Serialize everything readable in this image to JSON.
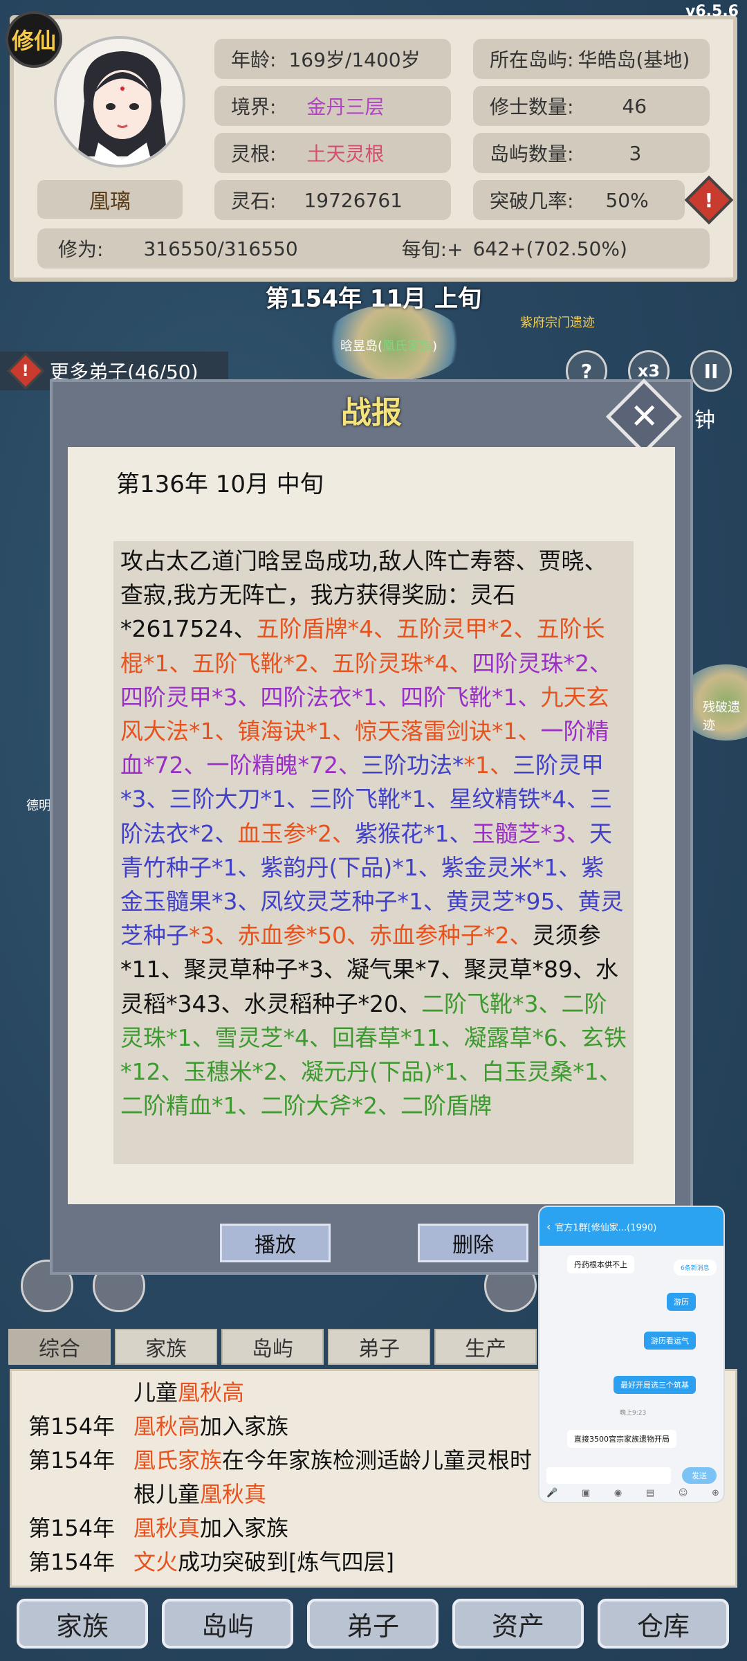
{
  "version": "v6.5.6",
  "badge": "修仙",
  "character": {
    "name": "凰璃",
    "age": {
      "label": "年龄:",
      "value": "169岁/1400岁"
    },
    "realm": {
      "label": "境界:",
      "value": "金丹三层"
    },
    "root": {
      "label": "灵根:",
      "value": "土天灵根"
    },
    "stone": {
      "label": "灵石:",
      "value": "19726761"
    },
    "island": {
      "label": "所在岛屿:",
      "value": "华皓岛(基地)"
    },
    "cultivators": {
      "label": "修士数量:",
      "value": "46"
    },
    "islands": {
      "label": "岛屿数量:",
      "value": "3"
    },
    "breakthrough": {
      "label": "突破几率:",
      "value": "50%"
    },
    "cultivation": {
      "label": "修为:",
      "value": "316550/316550"
    },
    "per_tick": {
      "label": "每旬:+",
      "value": "642+(702.50%)"
    }
  },
  "game_date": "第154年 11月 上旬",
  "map": {
    "labels": [
      "晗昱岛",
      "凰氏家族",
      "紫府宗门遗迹",
      "残破遗迹",
      "德明",
      "钟"
    ]
  },
  "more_disciples": "更多弟子(46/50)",
  "controls": {
    "help": "?",
    "speed": "x3",
    "pause": "II"
  },
  "dialog": {
    "title": "战报",
    "close": "✕",
    "report_date": "第136年 10月 中旬",
    "segments": [
      {
        "t": "攻占太乙道门晗昱岛成功,敌人阵亡寿蓉、贾晓、查寂,我方无阵亡，我方获得奖励：灵石*2617524、",
        "c": "black"
      },
      {
        "t": "五阶盾牌*4、五阶灵甲*2、五阶长棍*1、五阶飞靴*2、五阶灵珠*4、",
        "c": "orange"
      },
      {
        "t": "四阶灵珠*2、四阶灵甲*3、四阶法衣*1、四阶飞靴*1、",
        "c": "purple"
      },
      {
        "t": "九天玄风大法*1、镇海诀*1、惊天落雷剑诀*1、",
        "c": "orange"
      },
      {
        "t": "一阶精血*72、一阶精魄*72、",
        "c": "purple"
      },
      {
        "t": "三阶功法*",
        "c": "blue"
      },
      {
        "t": "*1、",
        "c": "orange"
      },
      {
        "t": "三阶灵甲*3、三阶大刀*1、三阶飞靴*1、星纹精铁*4、三阶法衣*2、",
        "c": "blue"
      },
      {
        "t": "血玉参*2、",
        "c": "orange"
      },
      {
        "t": "紫猴花*1、",
        "c": "blue"
      },
      {
        "t": "玉髓芝*3、",
        "c": "purple"
      },
      {
        "t": "天青竹种子*1、紫韵丹(下品)*1、紫金灵米*1、紫金玉髓果*3、凤纹灵芝种子*1、黄灵芝*95、黄灵芝种子",
        "c": "blue"
      },
      {
        "t": "*3、赤血参*50、赤血参种子*2、",
        "c": "orange"
      },
      {
        "t": "灵须参*11、聚灵草种子*3、凝气果*7、聚灵草*89、水灵稻*343、水灵稻种子*20、",
        "c": "black"
      },
      {
        "t": "二阶飞靴*3、二阶灵珠*1、雪灵芝*4、回春草*11、凝露草*6、玄铁*12、玉穗米*2、凝元丹(下品)*1、白玉灵桑*1、二阶精血*1、二阶大斧*2、二阶盾牌",
        "c": "green"
      }
    ],
    "play_button": "播放",
    "delete_button": "删除"
  },
  "chat": {
    "title": "官方1群[修仙家...(1990)",
    "msgs": [
      "丹药根本供不上",
      "游历",
      "游历看运气",
      "最好开局选三个筑基",
      "直接3500宫宗家族遗物开局"
    ],
    "badge": "6条新消息",
    "send": "发送",
    "time": "晚上9:23"
  },
  "tabs": [
    "综合",
    "家族",
    "岛屿",
    "弟子",
    "生产"
  ],
  "log": [
    {
      "year": "",
      "parts": [
        {
          "t": "儿童",
          "h": false
        },
        {
          "t": "凰秋高",
          "h": true
        }
      ]
    },
    {
      "year": "第154年",
      "parts": [
        {
          "t": "凰秋高",
          "h": true
        },
        {
          "t": "加入家族",
          "h": false
        }
      ]
    },
    {
      "year": "第154年",
      "parts": [
        {
          "t": "凰氏家族",
          "h": true
        },
        {
          "t": "在今年家族检测适龄儿童灵根时",
          "h": false
        }
      ]
    },
    {
      "year": "",
      "parts": [
        {
          "t": "根儿童",
          "h": false
        },
        {
          "t": "凰秋真",
          "h": true
        }
      ]
    },
    {
      "year": "第154年",
      "parts": [
        {
          "t": "凰秋真",
          "h": true
        },
        {
          "t": "加入家族",
          "h": false
        }
      ]
    },
    {
      "year": "第154年",
      "parts": [
        {
          "t": "文火",
          "h": true
        },
        {
          "t": "成功突破到[炼气四层]",
          "h": false
        }
      ]
    }
  ],
  "bottom_nav": [
    "家族",
    "岛屿",
    "弟子",
    "资产",
    "仓库"
  ]
}
